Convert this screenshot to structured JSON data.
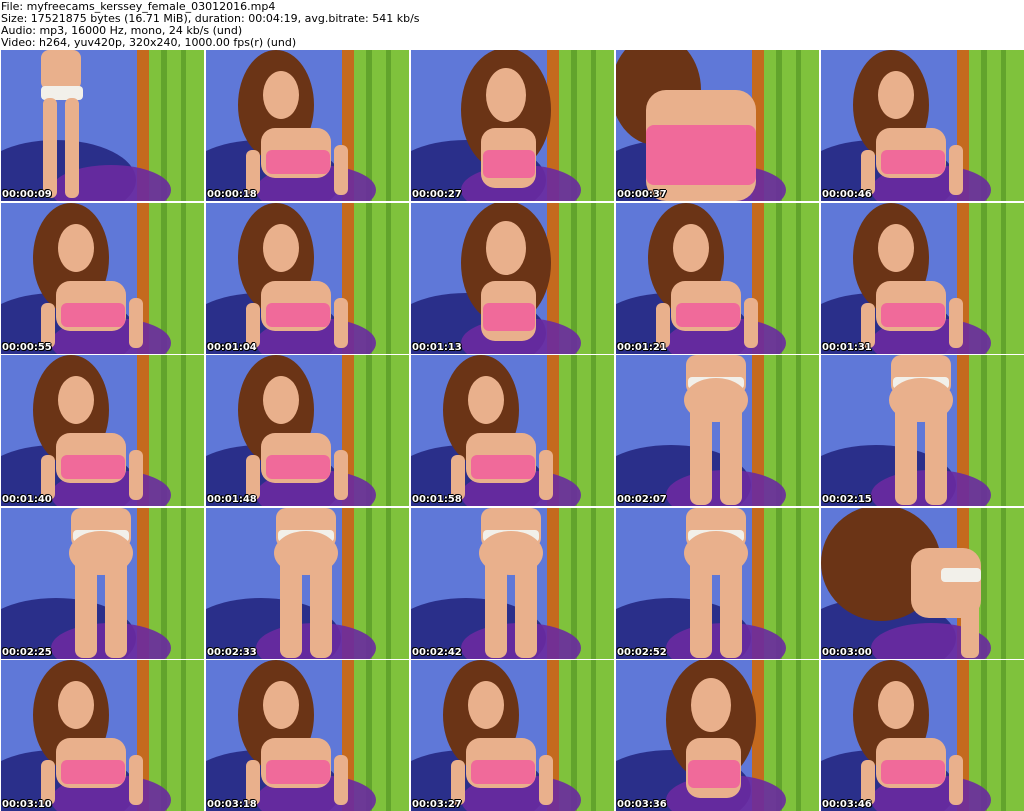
{
  "header": {
    "file_line": "File: myfreecams_kerssey_female_03012016.mp4",
    "size_line": "Size: 17521875 bytes (16.71 MiB), duration: 00:04:19, avg.bitrate: 541 kb/s",
    "audio_line": "Audio: mp3, 16000 Hz, mono, 24 kb/s (und)",
    "video_line": "Video: h264, yuv420p, 320x240, 1000.00 fps(r) (und)"
  },
  "colors": {
    "wall_blue": "#5f78d8",
    "curtain_green": "#7fc23c",
    "curtain_shadow": "#4f8f22",
    "frame_orange": "#c46a1e",
    "couch_blue": "#2a2f8a",
    "blanket_purple": "#6a2aa0",
    "skin": "#e9b08c",
    "hair": "#6b3416",
    "top_pink": "#f06a9a",
    "underwear": "#f2f0ea"
  },
  "thumbnails": [
    {
      "time": "00:00:09",
      "scene": "standing"
    },
    {
      "time": "00:00:18",
      "scene": "leaning"
    },
    {
      "time": "00:00:27",
      "scene": "portrait"
    },
    {
      "time": "00:00:37",
      "scene": "closeup"
    },
    {
      "time": "00:00:46",
      "scene": "leaning"
    },
    {
      "time": "00:00:55",
      "scene": "leaning"
    },
    {
      "time": "00:01:04",
      "scene": "leaning"
    },
    {
      "time": "00:01:13",
      "scene": "portrait"
    },
    {
      "time": "00:01:21",
      "scene": "leaning"
    },
    {
      "time": "00:01:31",
      "scene": "leaning"
    },
    {
      "time": "00:01:40",
      "scene": "leaning"
    },
    {
      "time": "00:01:48",
      "scene": "leaning"
    },
    {
      "time": "00:01:58",
      "scene": "leaning"
    },
    {
      "time": "00:02:07",
      "scene": "legs"
    },
    {
      "time": "00:02:15",
      "scene": "legs"
    },
    {
      "time": "00:02:25",
      "scene": "legs"
    },
    {
      "time": "00:02:33",
      "scene": "legs"
    },
    {
      "time": "00:02:42",
      "scene": "legs"
    },
    {
      "time": "00:02:52",
      "scene": "legs"
    },
    {
      "time": "00:03:00",
      "scene": "hair"
    },
    {
      "time": "00:03:10",
      "scene": "leaning"
    },
    {
      "time": "00:03:18",
      "scene": "leaning"
    },
    {
      "time": "00:03:27",
      "scene": "leaning"
    },
    {
      "time": "00:03:36",
      "scene": "portrait"
    },
    {
      "time": "00:03:46",
      "scene": "leaning"
    }
  ]
}
